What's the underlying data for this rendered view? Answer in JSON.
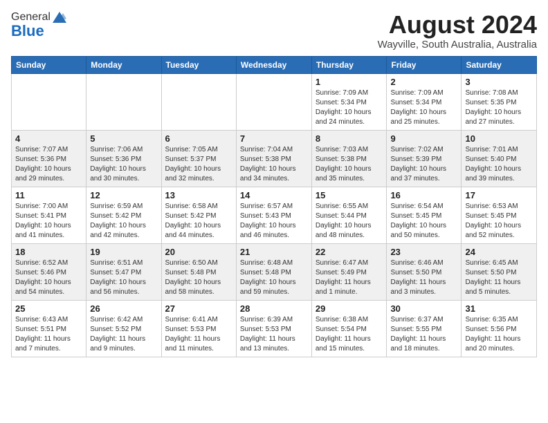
{
  "header": {
    "logo_general": "General",
    "logo_blue": "Blue",
    "month": "August 2024",
    "location": "Wayville, South Australia, Australia"
  },
  "weekdays": [
    "Sunday",
    "Monday",
    "Tuesday",
    "Wednesday",
    "Thursday",
    "Friday",
    "Saturday"
  ],
  "weeks": [
    [
      {
        "day": "",
        "info": ""
      },
      {
        "day": "",
        "info": ""
      },
      {
        "day": "",
        "info": ""
      },
      {
        "day": "",
        "info": ""
      },
      {
        "day": "1",
        "info": "Sunrise: 7:09 AM\nSunset: 5:34 PM\nDaylight: 10 hours\nand 24 minutes."
      },
      {
        "day": "2",
        "info": "Sunrise: 7:09 AM\nSunset: 5:34 PM\nDaylight: 10 hours\nand 25 minutes."
      },
      {
        "day": "3",
        "info": "Sunrise: 7:08 AM\nSunset: 5:35 PM\nDaylight: 10 hours\nand 27 minutes."
      }
    ],
    [
      {
        "day": "4",
        "info": "Sunrise: 7:07 AM\nSunset: 5:36 PM\nDaylight: 10 hours\nand 29 minutes."
      },
      {
        "day": "5",
        "info": "Sunrise: 7:06 AM\nSunset: 5:36 PM\nDaylight: 10 hours\nand 30 minutes."
      },
      {
        "day": "6",
        "info": "Sunrise: 7:05 AM\nSunset: 5:37 PM\nDaylight: 10 hours\nand 32 minutes."
      },
      {
        "day": "7",
        "info": "Sunrise: 7:04 AM\nSunset: 5:38 PM\nDaylight: 10 hours\nand 34 minutes."
      },
      {
        "day": "8",
        "info": "Sunrise: 7:03 AM\nSunset: 5:38 PM\nDaylight: 10 hours\nand 35 minutes."
      },
      {
        "day": "9",
        "info": "Sunrise: 7:02 AM\nSunset: 5:39 PM\nDaylight: 10 hours\nand 37 minutes."
      },
      {
        "day": "10",
        "info": "Sunrise: 7:01 AM\nSunset: 5:40 PM\nDaylight: 10 hours\nand 39 minutes."
      }
    ],
    [
      {
        "day": "11",
        "info": "Sunrise: 7:00 AM\nSunset: 5:41 PM\nDaylight: 10 hours\nand 41 minutes."
      },
      {
        "day": "12",
        "info": "Sunrise: 6:59 AM\nSunset: 5:42 PM\nDaylight: 10 hours\nand 42 minutes."
      },
      {
        "day": "13",
        "info": "Sunrise: 6:58 AM\nSunset: 5:42 PM\nDaylight: 10 hours\nand 44 minutes."
      },
      {
        "day": "14",
        "info": "Sunrise: 6:57 AM\nSunset: 5:43 PM\nDaylight: 10 hours\nand 46 minutes."
      },
      {
        "day": "15",
        "info": "Sunrise: 6:55 AM\nSunset: 5:44 PM\nDaylight: 10 hours\nand 48 minutes."
      },
      {
        "day": "16",
        "info": "Sunrise: 6:54 AM\nSunset: 5:45 PM\nDaylight: 10 hours\nand 50 minutes."
      },
      {
        "day": "17",
        "info": "Sunrise: 6:53 AM\nSunset: 5:45 PM\nDaylight: 10 hours\nand 52 minutes."
      }
    ],
    [
      {
        "day": "18",
        "info": "Sunrise: 6:52 AM\nSunset: 5:46 PM\nDaylight: 10 hours\nand 54 minutes."
      },
      {
        "day": "19",
        "info": "Sunrise: 6:51 AM\nSunset: 5:47 PM\nDaylight: 10 hours\nand 56 minutes."
      },
      {
        "day": "20",
        "info": "Sunrise: 6:50 AM\nSunset: 5:48 PM\nDaylight: 10 hours\nand 58 minutes."
      },
      {
        "day": "21",
        "info": "Sunrise: 6:48 AM\nSunset: 5:48 PM\nDaylight: 10 hours\nand 59 minutes."
      },
      {
        "day": "22",
        "info": "Sunrise: 6:47 AM\nSunset: 5:49 PM\nDaylight: 11 hours\nand 1 minute."
      },
      {
        "day": "23",
        "info": "Sunrise: 6:46 AM\nSunset: 5:50 PM\nDaylight: 11 hours\nand 3 minutes."
      },
      {
        "day": "24",
        "info": "Sunrise: 6:45 AM\nSunset: 5:50 PM\nDaylight: 11 hours\nand 5 minutes."
      }
    ],
    [
      {
        "day": "25",
        "info": "Sunrise: 6:43 AM\nSunset: 5:51 PM\nDaylight: 11 hours\nand 7 minutes."
      },
      {
        "day": "26",
        "info": "Sunrise: 6:42 AM\nSunset: 5:52 PM\nDaylight: 11 hours\nand 9 minutes."
      },
      {
        "day": "27",
        "info": "Sunrise: 6:41 AM\nSunset: 5:53 PM\nDaylight: 11 hours\nand 11 minutes."
      },
      {
        "day": "28",
        "info": "Sunrise: 6:39 AM\nSunset: 5:53 PM\nDaylight: 11 hours\nand 13 minutes."
      },
      {
        "day": "29",
        "info": "Sunrise: 6:38 AM\nSunset: 5:54 PM\nDaylight: 11 hours\nand 15 minutes."
      },
      {
        "day": "30",
        "info": "Sunrise: 6:37 AM\nSunset: 5:55 PM\nDaylight: 11 hours\nand 18 minutes."
      },
      {
        "day": "31",
        "info": "Sunrise: 6:35 AM\nSunset: 5:56 PM\nDaylight: 11 hours\nand 20 minutes."
      }
    ]
  ]
}
